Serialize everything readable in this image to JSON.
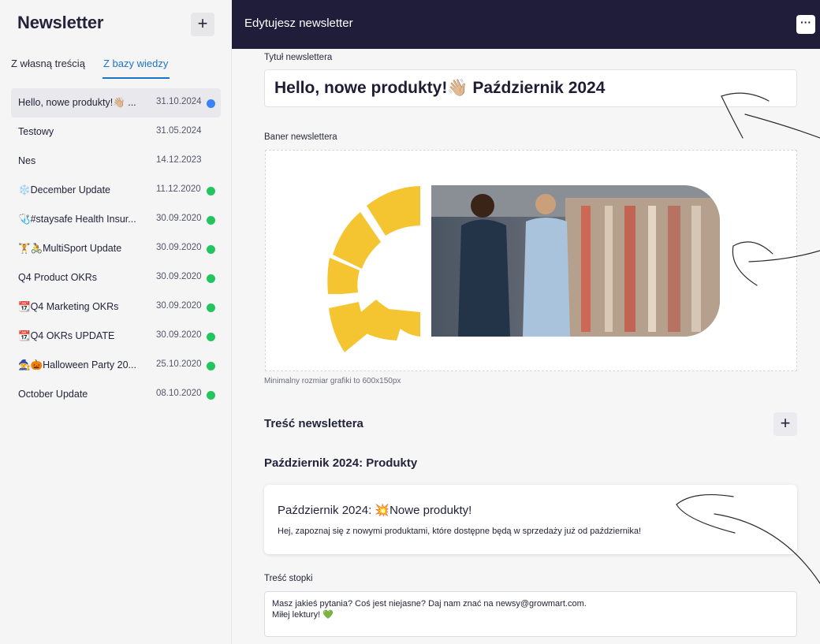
{
  "sidebar": {
    "title": "Newsletter",
    "add_label": "+",
    "tabs": [
      {
        "label": "Z własną treścią"
      },
      {
        "label": "Z bazy wiedzy"
      }
    ],
    "items": [
      {
        "name": "Hello, nowe produkty!👋🏼 ...",
        "date": "31.10.2024",
        "status": "blue"
      },
      {
        "name": "Testowy",
        "date": "31.05.2024",
        "status": "none"
      },
      {
        "name": "Nes",
        "date": "14.12.2023",
        "status": "none"
      },
      {
        "name": "❄️December Update",
        "date": "11.12.2020",
        "status": "green"
      },
      {
        "name": "🩺#staysafe Health Insur...",
        "date": "30.09.2020",
        "status": "green"
      },
      {
        "name": "🏋️🚴MultiSport Update",
        "date": "30.09.2020",
        "status": "green"
      },
      {
        "name": "Q4 Product OKRs",
        "date": "30.09.2020",
        "status": "green"
      },
      {
        "name": "📆Q4 Marketing OKRs",
        "date": "30.09.2020",
        "status": "green"
      },
      {
        "name": "📆Q4 OKRs UPDATE",
        "date": "30.09.2020",
        "status": "green"
      },
      {
        "name": "🧙🎃Halloween Party 20...",
        "date": "25.10.2020",
        "status": "green"
      },
      {
        "name": "October Update",
        "date": "08.10.2020",
        "status": "green"
      }
    ]
  },
  "topbar": {
    "title": "Edytujesz newsletter",
    "more_label": "···"
  },
  "form": {
    "title_label": "Tytuł newslettera",
    "title_value": "Hello, nowe produkty!👋🏼 Październik 2024",
    "banner_label": "Baner newslettera",
    "banner_helper": "Minimalny rozmiar grafiki to 600x150px",
    "content_title": "Treść newslettera",
    "content_add_label": "+",
    "section_title": "Październik 2024: Produkty",
    "card_title": "Październik 2024: 💥Nowe produkty!",
    "card_desc": "Hej, zapoznaj się z nowymi produktami, które dostępne będą w sprzedaży już od października!",
    "footer_label": "Treść stopki",
    "footer_line1": "Masz jakieś pytania? Coś jest niejasne? Daj nam znać na newsy@growmart.com.",
    "footer_line2": "Miłej lektury! 💚"
  },
  "colors": {
    "topbar": "#1f1d3a",
    "accent": "#1c74c9",
    "status_green": "#22c55e",
    "status_blue": "#3b82f6",
    "sun": "#f5c531"
  }
}
